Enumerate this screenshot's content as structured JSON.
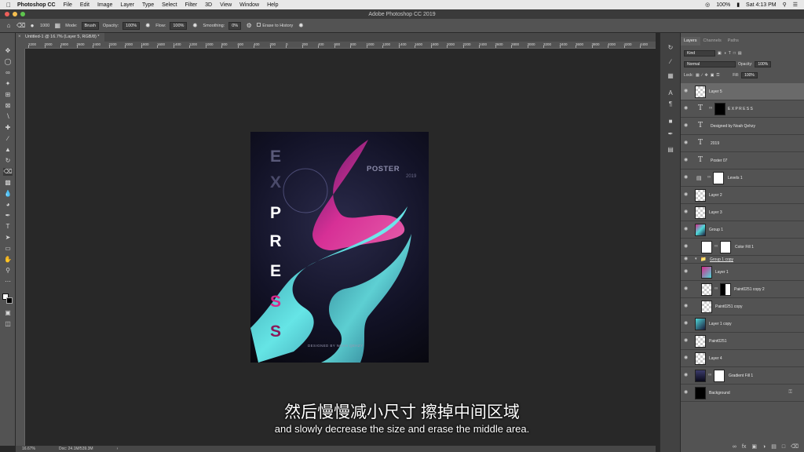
{
  "menubar": {
    "app_name": "Photoshop CC",
    "items": [
      "File",
      "Edit",
      "Image",
      "Layer",
      "Type",
      "Select",
      "Filter",
      "3D",
      "View",
      "Window",
      "Help"
    ],
    "battery": "100%",
    "time": "Sat 4:13 PM"
  },
  "window": {
    "title": "Adobe Photoshop CC 2019"
  },
  "options_bar": {
    "brush_size": "1000",
    "mode_label": "Mode:",
    "mode_value": "Brush",
    "opacity_label": "Opacity:",
    "opacity_value": "100%",
    "flow_label": "Flow:",
    "flow_value": "100%",
    "smoothing_label": "Smoothing:",
    "smoothing_value": "0%",
    "erase_history": "Erase to History"
  },
  "document": {
    "tab_title": "Untitled-1 @ 16.7% (Layer 5, RGB/8) *",
    "zoom": "16.67%",
    "doc_info": "Doc: 24.1M/539.3M"
  },
  "ruler_labels": [
    "2200",
    "2000",
    "2800",
    "2600",
    "2400",
    "2200",
    "2000",
    "1800",
    "1600",
    "1400",
    "1200",
    "1000",
    "800",
    "600",
    "400",
    "200",
    "0",
    "200",
    "400",
    "600",
    "800",
    "1000",
    "1200",
    "1400",
    "1600",
    "1800",
    "2000",
    "2200",
    "2400",
    "2600",
    "2800",
    "3000",
    "3200",
    "3400",
    "3600",
    "3800",
    "4000",
    "4200",
    "4400",
    "4600",
    "4800"
  ],
  "poster": {
    "title": "POSTER",
    "year": "2019",
    "letters": [
      "E",
      "X",
      "P",
      "R",
      "E",
      "S",
      "S"
    ],
    "footer": "DESIGNED BY NOAH QEHZY"
  },
  "subtitles": {
    "cn": "然后慢慢减小尺寸 擦掉中间区域",
    "en": "and slowly decrease the size and erase the middle area."
  },
  "layers_panel": {
    "tabs": [
      "Layers",
      "Channels",
      "Paths"
    ],
    "kind_label": "Kind",
    "blend_mode": "Normal",
    "opacity_label": "Opacity:",
    "opacity_value": "100%",
    "lock_label": "Lock:",
    "fill_label": "Fill:",
    "fill_value": "100%",
    "layers": [
      {
        "name": "Layer 5",
        "type": "pixel",
        "selected": true
      },
      {
        "name": "E X P R E S S",
        "type": "text"
      },
      {
        "name": "Designed by Noah Qehzy",
        "type": "text"
      },
      {
        "name": "2019",
        "type": "text"
      },
      {
        "name": "Poster 07",
        "type": "text"
      },
      {
        "name": "Levels 1",
        "type": "adjustment"
      },
      {
        "name": "Layer 2",
        "type": "pixel"
      },
      {
        "name": "Layer 3",
        "type": "pixel"
      },
      {
        "name": "Group 1",
        "type": "pixel"
      },
      {
        "name": "Color Fill 1",
        "type": "fill"
      },
      {
        "name": "Group 1 copy",
        "type": "group"
      },
      {
        "name": "Layer 1",
        "type": "pixel"
      },
      {
        "name": "Paint0251 copy 2",
        "type": "masked"
      },
      {
        "name": "Paint0251 copy",
        "type": "pixel"
      },
      {
        "name": "Layer 1 copy",
        "type": "pixel"
      },
      {
        "name": "Paint0251",
        "type": "pixel"
      },
      {
        "name": "Layer 4",
        "type": "pixel"
      },
      {
        "name": "Gradient Fill 1",
        "type": "fill"
      },
      {
        "name": "Background",
        "type": "background"
      }
    ]
  },
  "colors": {
    "accent_pink": "#d62a8a",
    "accent_cyan": "#4fd8d8",
    "poster_bg": "#121226"
  }
}
